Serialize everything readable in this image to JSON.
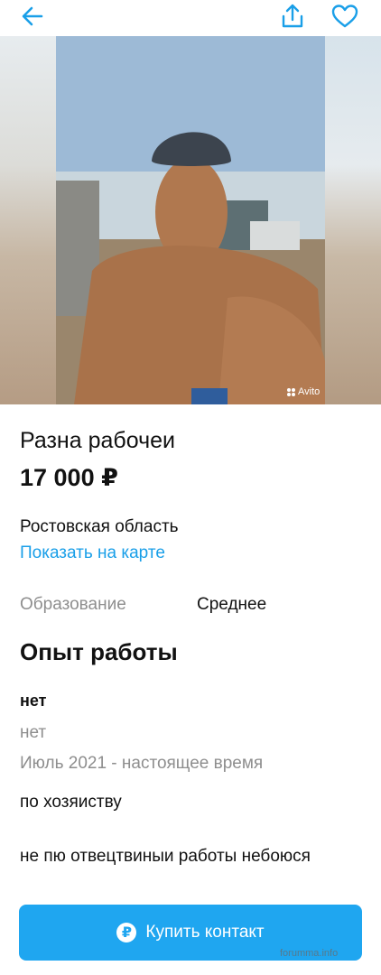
{
  "header": {
    "back_icon": "arrow-left-icon",
    "share_icon": "share-icon",
    "favorite_icon": "heart-icon",
    "accent_color": "#1a9fe8"
  },
  "gallery": {
    "watermark_label": "Avito"
  },
  "listing": {
    "title": "Разна рабочеи",
    "price": "17 000 ₽",
    "region": "Ростовская область",
    "map_link": "Показать на карте"
  },
  "params": {
    "education_label": "Образование",
    "education_value": "Среднее"
  },
  "experience": {
    "title": "Опыт работы",
    "company": "нет",
    "position": "нет",
    "period": "Июль 2021 - настоящее время",
    "duties": "по хозяиству"
  },
  "about": "не пю отвецтвиныи работы небоюся",
  "action": {
    "buy_label": "Купить контакт",
    "button_color": "#1fa6f0"
  },
  "watermark": "forumma.info"
}
